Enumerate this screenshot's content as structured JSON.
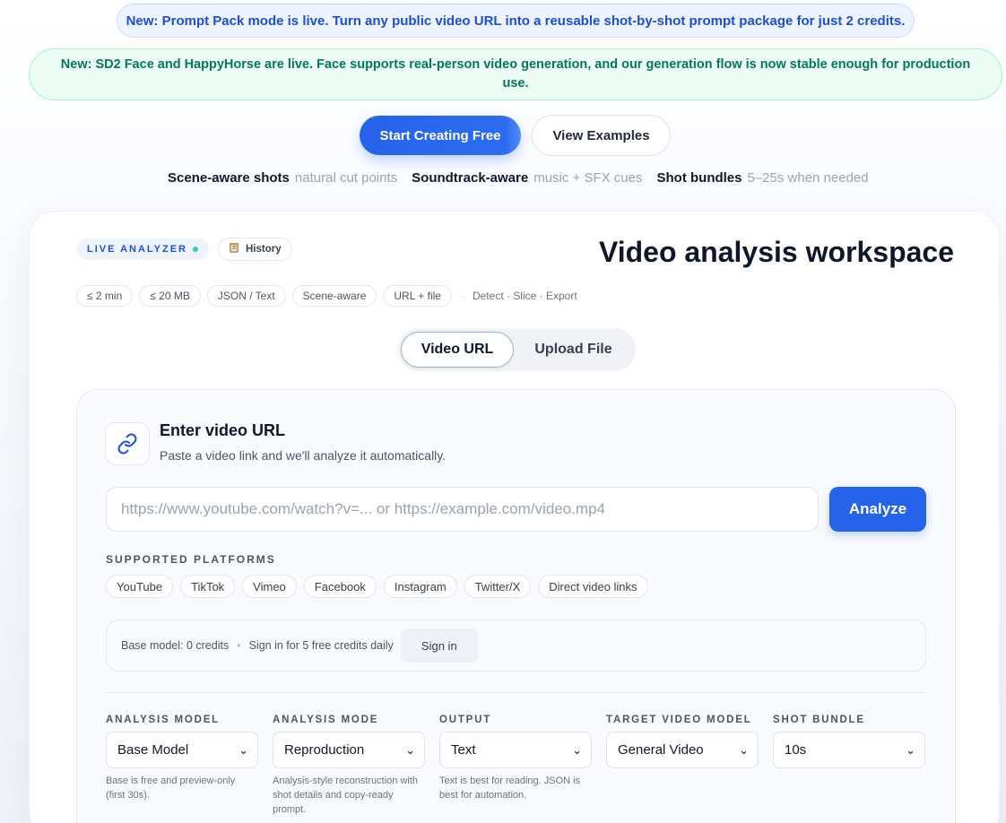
{
  "banners": {
    "prompt_pack": "New: Prompt Pack mode is live. Turn any public video URL into a reusable shot-by-shot prompt package for just 2 credits.",
    "sd2_face": "New: SD2 Face and HappyHorse are live. Face supports real-person video generation, and our generation flow is now stable enough for production use."
  },
  "hero": {
    "primary_cta": "Start Creating Free",
    "secondary_cta": "View Examples",
    "features": [
      {
        "title": "Scene-aware shots",
        "desc": "natural cut points"
      },
      {
        "title": "Soundtrack-aware",
        "desc": "music + SFX cues"
      },
      {
        "title": "Shot bundles",
        "desc": "5–25s when needed"
      }
    ]
  },
  "workspace": {
    "badge": "LIVE ANALYZER",
    "history": "History",
    "title": "Video analysis workspace",
    "tags": [
      "≤ 2 min",
      "≤ 20 MB",
      "JSON / Text",
      "Scene-aware",
      "URL + file"
    ],
    "meta_dot": "·",
    "meta": "Detect · Slice · Export",
    "tabs": {
      "url": "Video URL",
      "upload": "Upload File"
    }
  },
  "url_panel": {
    "title": "Enter video URL",
    "subtitle": "Paste a video link and we'll analyze it automatically.",
    "placeholder": "https://www.youtube.com/watch?v=... or https://example.com/video.mp4",
    "analyze": "Analyze",
    "platforms_label": "SUPPORTED PLATFORMS",
    "platforms": [
      "YouTube",
      "TikTok",
      "Vimeo",
      "Facebook",
      "Instagram",
      "Twitter/X",
      "Direct video links"
    ],
    "credits": {
      "base": "Base model: 0 credits",
      "sep": "•",
      "signin_note": "Sign in for 5 free credits daily",
      "signin_btn": "Sign in"
    },
    "selects": [
      {
        "label": "ANALYSIS MODEL",
        "value": "Base Model",
        "help": "Base is free and preview-only (first 30s)."
      },
      {
        "label": "ANALYSIS MODE",
        "value": "Reproduction",
        "help": "Analysis-style reconstruction with shot details and copy-ready prompt."
      },
      {
        "label": "OUTPUT",
        "value": "Text",
        "help": "Text is best for reading. JSON is best for automation."
      },
      {
        "label": "TARGET VIDEO MODEL",
        "value": "General Video",
        "help": ""
      },
      {
        "label": "SHOT BUNDLE",
        "value": "10s",
        "help": ""
      }
    ]
  },
  "colors": {
    "accent": "#2563eb",
    "success_bg": "#ecfdf5",
    "success_text": "#047857",
    "info_bg": "#eef4ff"
  },
  "icons": {
    "link": "link-icon",
    "history": "scroll-icon",
    "chevron": "chevron-down-icon"
  }
}
